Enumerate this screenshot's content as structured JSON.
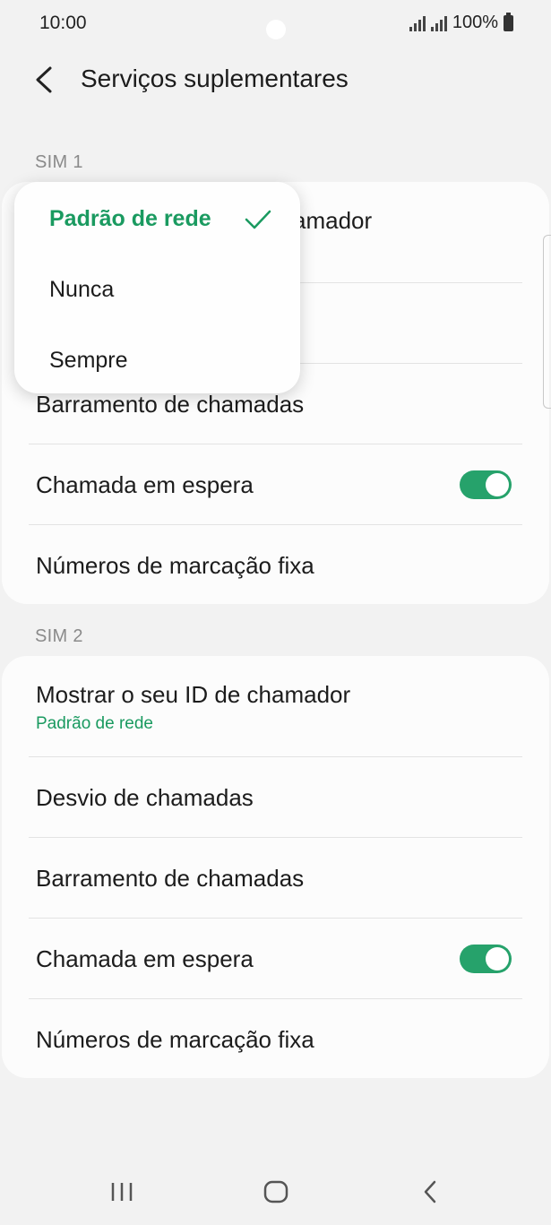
{
  "status": {
    "time": "10:00",
    "battery": "100%"
  },
  "header": {
    "title": "Serviços suplementares"
  },
  "sim1": {
    "label": "SIM 1",
    "caller_id_partial": "amador",
    "items": [
      {
        "label": "Barramento de chamadas"
      },
      {
        "label": "Chamada em espera",
        "toggle_on": true
      },
      {
        "label": "Números de marcação fixa"
      }
    ]
  },
  "sim2": {
    "label": "SIM 2",
    "caller_id": {
      "label": "Mostrar o seu ID de chamador",
      "value": "Padrão de rede"
    },
    "items": [
      {
        "label": "Desvio de chamadas"
      },
      {
        "label": "Barramento de chamadas"
      },
      {
        "label": "Chamada em espera",
        "toggle_on": true
      },
      {
        "label": "Números de marcação fixa"
      }
    ]
  },
  "popup": {
    "options": [
      {
        "label": "Padrão de rede",
        "selected": true
      },
      {
        "label": "Nunca",
        "selected": false
      },
      {
        "label": "Sempre",
        "selected": false
      }
    ]
  },
  "icons": {
    "back": "chevron-left-icon",
    "check": "checkmark-icon",
    "nav_recent": "recent-apps-icon",
    "nav_home": "home-icon",
    "nav_back": "back-icon"
  },
  "colors": {
    "accent": "#1a9a60",
    "toggle": "#26a26b",
    "background": "#f2f2f2"
  }
}
